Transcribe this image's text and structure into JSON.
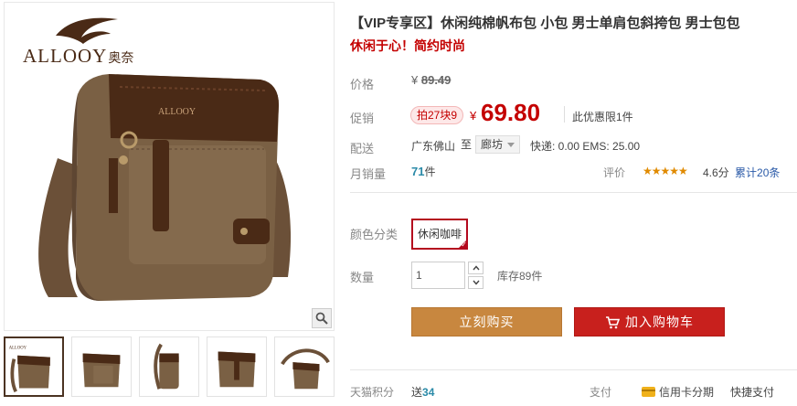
{
  "brand": {
    "name": "ALLOOY",
    "name_cn": "奥奈"
  },
  "product": {
    "title": "【VIP专享区】休闲纯棉帆布包 小包 男士单肩包斜挎包 男士包包",
    "subtitle": "休闲于心！简约时尚"
  },
  "price": {
    "label": "价格",
    "currency": "¥",
    "original": "89.49"
  },
  "promo": {
    "label": "促销",
    "tag": "拍27块9",
    "currency": "¥",
    "price": "69.80",
    "limit_note": "此优惠限1件"
  },
  "shipping": {
    "label": "配送",
    "from": "广东佛山",
    "to_word": "至",
    "destination": "廊坊",
    "fees": "快递: 0.00 EMS: 25.00"
  },
  "sales": {
    "label": "月销量",
    "count": "71",
    "unit": "件",
    "rating_label": "评价",
    "stars": "★★★★★",
    "score": "4.6分",
    "reviews_prefix": "累计",
    "reviews_count": "20",
    "reviews_suffix": "条",
    "rating_value": 4.6
  },
  "options": {
    "color_label": "颜色分类",
    "color_selected": "休闲咖啡"
  },
  "quantity": {
    "label": "数量",
    "value": "1",
    "stock": "库存89件"
  },
  "actions": {
    "buy_now": "立刻购买",
    "add_to_cart": "加入购物车"
  },
  "footer": {
    "points_label": "天猫积分",
    "points_prefix": "送",
    "points_value": "34",
    "pay_label": "支付",
    "pay_card": "信用卡分期",
    "pay_fast": "快捷支付"
  },
  "icons": {
    "zoom": "magnifier-icon",
    "cart": "cart-icon",
    "card": "credit-card-icon",
    "spin_up": "chevron-up-icon",
    "spin_down": "chevron-down-icon",
    "destination_caret": "caret-down-icon"
  },
  "colors": {
    "price_red": "#c40000",
    "buy_orange": "#c8873f",
    "cart_red": "#c8201d",
    "selected_border": "#b4091e",
    "link_blue": "#2a5aa8",
    "count_teal": "#2a8aa8",
    "bag_canvas": "#7a6044",
    "bag_leather": "#4a2a16"
  },
  "gallery": {
    "thumbnail_count": 5,
    "active_index": 0
  }
}
